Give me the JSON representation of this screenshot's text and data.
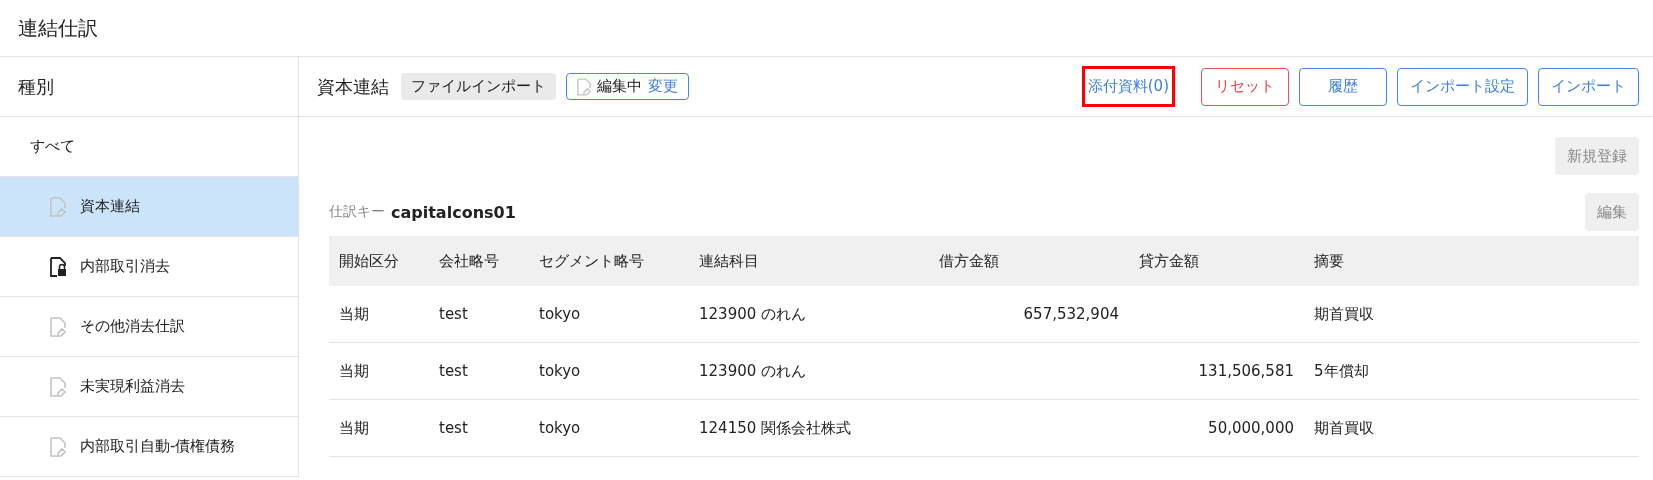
{
  "title": "連結仕訳",
  "sidebar": {
    "heading": "種別",
    "items": [
      {
        "label": "すべて",
        "selected": false,
        "children": [
          {
            "label": "資本連結",
            "kind": "edit",
            "selected": true
          },
          {
            "label": "内部取引消去",
            "kind": "locked",
            "selected": false
          },
          {
            "label": "その他消去仕訳",
            "kind": "edit",
            "selected": false
          },
          {
            "label": "未実現利益消去",
            "kind": "edit",
            "selected": false
          },
          {
            "label": "内部取引自動-債権債務",
            "kind": "edit",
            "selected": false
          }
        ]
      }
    ]
  },
  "toolbar": {
    "name": "資本連結",
    "tag": "ファイルインポート",
    "status": {
      "label": "編集中",
      "link": "変更"
    },
    "attachment": {
      "label": "添付資料(0)",
      "highlighted": true
    },
    "buttons": [
      {
        "label": "リセット",
        "kind": "danger"
      },
      {
        "label": "履歴",
        "kind": "primary"
      },
      {
        "label": "インポート設定",
        "kind": "primary"
      },
      {
        "label": "インポート",
        "kind": "primary"
      }
    ]
  },
  "new_button": "新規登録",
  "entry": {
    "key_label": "仕訳キー",
    "key": "capitalcons01",
    "edit_button": "編集"
  },
  "table": {
    "columns": [
      "開始区分",
      "会社略号",
      "セグメント略号",
      "連結科目",
      "借方金額",
      "貸方金額",
      "摘要"
    ],
    "rows": [
      [
        "当期",
        "test",
        "tokyo",
        "123900 のれん",
        "657,532,904",
        "",
        "期首買収"
      ],
      [
        "当期",
        "test",
        "tokyo",
        "123900 のれん",
        "",
        "131,506,581",
        "5年償却"
      ],
      [
        "当期",
        "test",
        "tokyo",
        "124150 関係会社株式",
        "",
        "50,000,000",
        "期首買収"
      ]
    ]
  }
}
